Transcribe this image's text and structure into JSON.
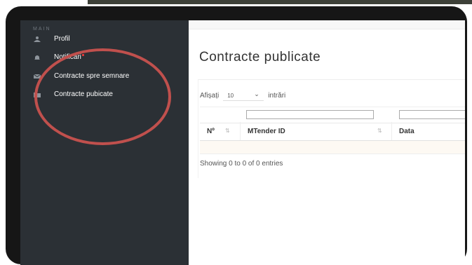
{
  "sidebar": {
    "section_label": "MAIN",
    "items": [
      {
        "label": "Profil",
        "icon": "user-icon"
      },
      {
        "label": "Notificări",
        "icon": "bell-icon",
        "badge_color": "#ff3b3b"
      },
      {
        "label": "Contracte spre semnare",
        "icon": "envelope-icon"
      },
      {
        "label": "Contracte pubicate",
        "icon": "folder-icon"
      }
    ]
  },
  "main": {
    "title": "Contracte publicate",
    "length_menu": {
      "prefix": "Afișați",
      "value": "10",
      "suffix": "intrări"
    },
    "table": {
      "columns": [
        {
          "label": "Nº"
        },
        {
          "label": "MTender ID"
        },
        {
          "label": "Data"
        }
      ],
      "rows": []
    },
    "info": "Showing 0 to 0 of 0 entries"
  },
  "annotation": {
    "color": "#c0504d"
  }
}
